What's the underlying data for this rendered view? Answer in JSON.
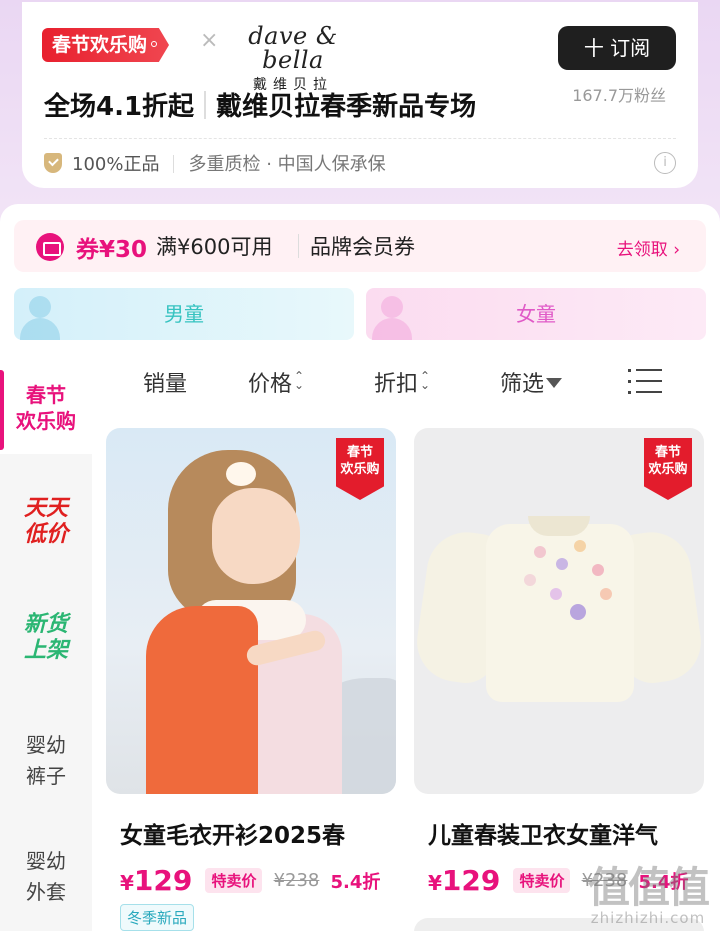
{
  "store": {
    "event_badge": "春节欢乐购",
    "times": "×",
    "brand_en": "dave & bella",
    "brand_cn": "戴维贝拉",
    "subscribe_label": "十 订阅",
    "fans": "167.7万粉丝",
    "promo": "全场4.1折起",
    "title": "戴维贝拉春季新品专场",
    "trust": {
      "genuine": "100%正品",
      "guarantee": "多重质检 · 中国人保承保"
    },
    "info": "i"
  },
  "coupon": {
    "amount": "券¥30",
    "condition": "满¥600可用",
    "type": "品牌会员券",
    "claim": "去领取 ›"
  },
  "gender_tabs": {
    "boy": "男童",
    "girl": "女童"
  },
  "categories": [
    {
      "label": "春节欢乐购",
      "line1": "春节",
      "line2": "欢乐购",
      "active": true
    },
    {
      "label": "天天低价",
      "line1": "天天",
      "line2": "低价"
    },
    {
      "label": "新货上架",
      "line1": "新货",
      "line2": "上架"
    },
    {
      "label": "婴幼裤子",
      "line1": "婴幼",
      "line2": "裤子"
    },
    {
      "label": "婴幼外套",
      "line1": "婴幼",
      "line2": "外套"
    }
  ],
  "sort": {
    "sales": "销量",
    "price": "价格",
    "discount": "折扣",
    "filter": "筛选"
  },
  "products": [
    {
      "badge_1": "春节",
      "badge_2": "欢乐购",
      "title": "女童毛衣开衫2025春",
      "currency": "¥",
      "price": "129",
      "special_label": "特卖价",
      "original_price": "¥238",
      "discount": "5.4折",
      "season_tag": "冬季新品"
    },
    {
      "badge_1": "春节",
      "badge_2": "欢乐购",
      "title": "儿童春装卫衣女童洋气",
      "currency": "¥",
      "price": "129",
      "special_label": "特卖价",
      "original_price": "¥238",
      "discount": "5.4折"
    }
  ],
  "watermark": {
    "logo": "值值值",
    "site": "zhizhizhi.com"
  },
  "colors": {
    "accent": "#e8127c",
    "festive_red": "#e31c2c",
    "boy_teal": "#36c3c0",
    "girl_pink": "#e05ac7"
  }
}
